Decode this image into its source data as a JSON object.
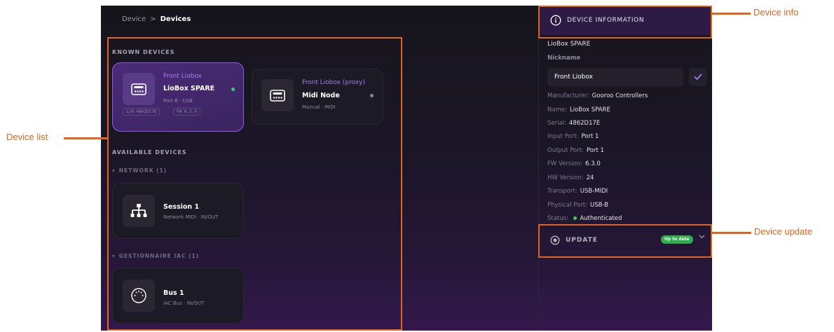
{
  "breadcrumb": {
    "root": "Device",
    "separator": ">",
    "current": "Devices"
  },
  "known_devices": {
    "heading": "KNOWN DEVICES",
    "cards": [
      {
        "nickname": "Front Liobox",
        "name": "LioBox SPARE",
        "sub": "Port B · USB",
        "serial_tag": "S/N 4862D17E",
        "fw_tag": "FW 6.3.0",
        "status_color": "#3ccf5c",
        "icon": "liobox-icon"
      },
      {
        "nickname": "Front Liobox (proxy)",
        "name": "Midi Node",
        "sub": "Manual · MIDI",
        "status_color": "#8a8799",
        "icon": "liobox-icon"
      }
    ]
  },
  "available_devices": {
    "heading": "AVAILABLE DEVICES",
    "groups": [
      {
        "title": "NETWORK (1)",
        "card": {
          "name": "Session 1",
          "sub": "Network MIDI · IN/OUT",
          "icon": "network-icon"
        }
      },
      {
        "title": "GESTIONNAIRE IAC (1)",
        "card": {
          "name": "Bus 1",
          "sub": "IAC Bus · IN/OUT",
          "icon": "midi-port-icon"
        }
      }
    ]
  },
  "device_info": {
    "header": "DEVICE INFORMATION",
    "device_name": "LioBox SPARE",
    "nickname_label": "Nickname",
    "nickname_value": "Front Liobox",
    "fields": [
      {
        "key": "Manufacturer:",
        "value": "Gooroo Controllers"
      },
      {
        "key": "Name:",
        "value": "LioBox SPARE"
      },
      {
        "key": "Serial:",
        "value": "4862D17E"
      },
      {
        "key": "Input Port:",
        "value": "Port 1"
      },
      {
        "key": "Output Port:",
        "value": "Port 1"
      },
      {
        "key": "FW Version:",
        "value": "6.3.0"
      },
      {
        "key": "HW Version:",
        "value": "24"
      },
      {
        "key": "Transport:",
        "value": "USB-MIDI"
      },
      {
        "key": "Physical Port:",
        "value": "USB-B"
      }
    ],
    "status_key": "Status:",
    "status_value": "Authenticated",
    "status_color": "#3ccf5c"
  },
  "update": {
    "label": "UPDATE",
    "badge": "Up to date",
    "badge_color": "#2fae4e"
  },
  "annotations": {
    "device_list": "Device list",
    "device_info": "Device info",
    "device_update": "Device update"
  },
  "colors": {
    "accent": "#a77df0",
    "annotation": "#e3641f"
  }
}
